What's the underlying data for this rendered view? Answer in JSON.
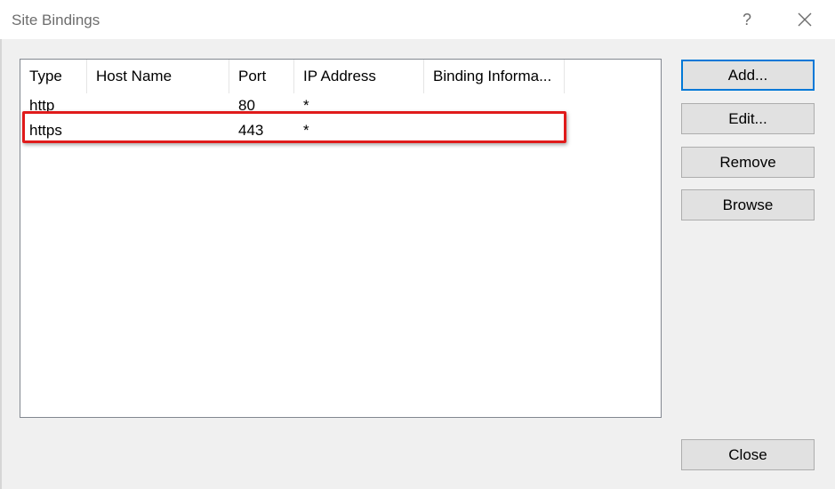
{
  "window": {
    "title": "Site Bindings",
    "help": "?",
    "close_icon": "close-icon"
  },
  "bindings": {
    "columns": [
      "Type",
      "Host Name",
      "Port",
      "IP Address",
      "Binding Informa..."
    ],
    "rows": [
      {
        "type": "http",
        "host": "",
        "port": "80",
        "ip": "*",
        "info": ""
      },
      {
        "type": "https",
        "host": "",
        "port": "443",
        "ip": "*",
        "info": ""
      }
    ],
    "highlighted_row": "https",
    "highlight_color": "#e01b1b"
  },
  "buttons": {
    "add": "Add...",
    "edit": "Edit...",
    "remove": "Remove",
    "browse": "Browse",
    "close": "Close"
  },
  "colors": {
    "default_button_border": "#0078d7",
    "button_face": "#e1e1e1",
    "dialog_background": "#f0f0f0"
  }
}
